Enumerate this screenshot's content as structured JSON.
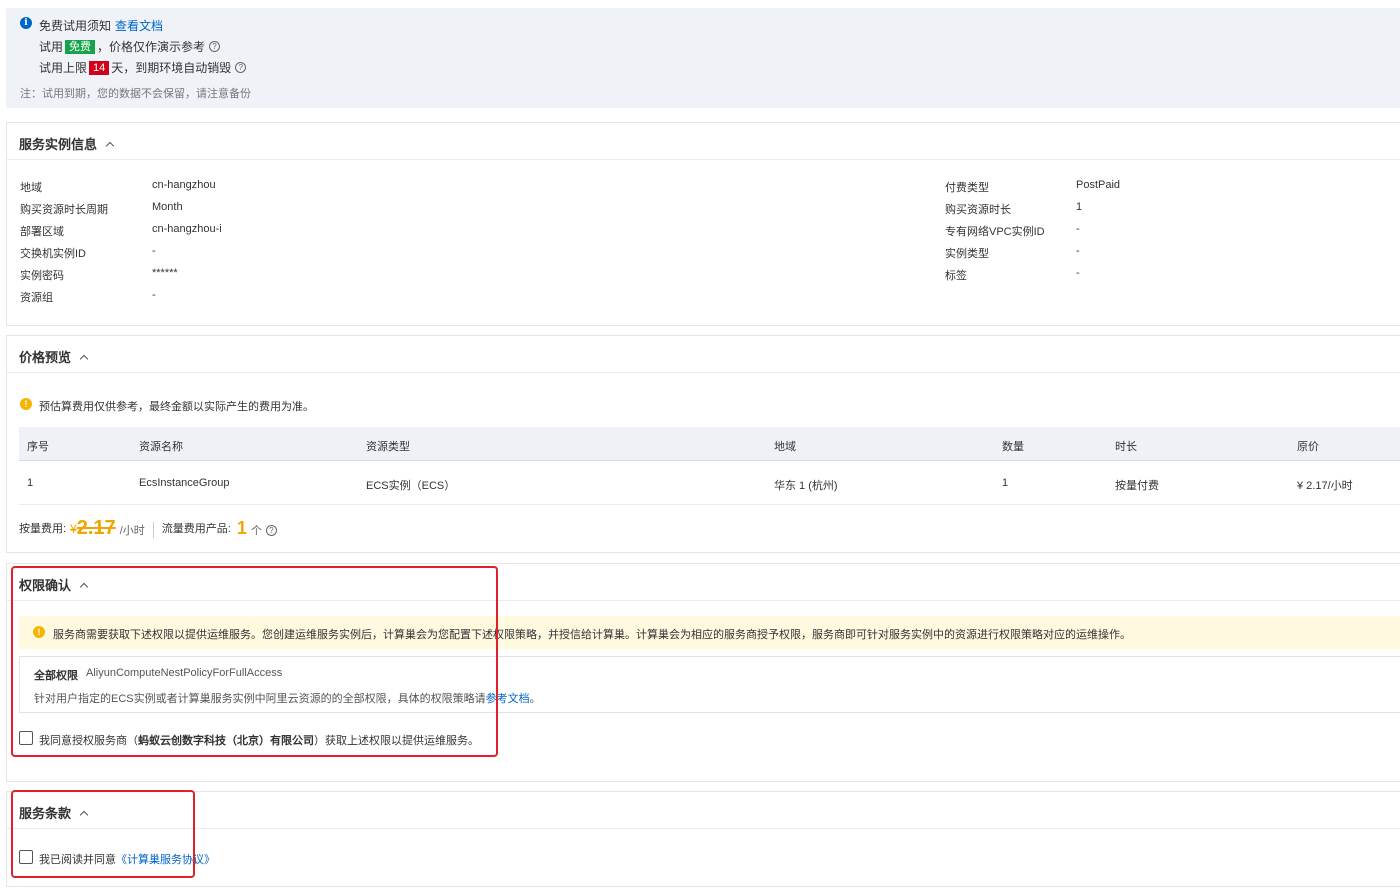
{
  "notice": {
    "title": "免费试用须知",
    "doc_link": "查看文档",
    "row1_prefix": "试用",
    "row1_badge": "免费",
    "row1_suffix": "，价格仅作演示参考",
    "row2_prefix": "试用上限",
    "row2_badge": "14",
    "row2_suffix": "天，到期环境自动销毁",
    "footnote": "注：试用到期，您的数据不会保留，请注意备份"
  },
  "service_info": {
    "title": "服务实例信息",
    "left": [
      {
        "label": "地域",
        "value": "cn-hangzhou"
      },
      {
        "label": "购买资源时长周期",
        "value": "Month"
      },
      {
        "label": "部署区域",
        "value": "cn-hangzhou-i"
      },
      {
        "label": "交换机实例ID",
        "value": "-"
      },
      {
        "label": "实例密码",
        "value": "******"
      },
      {
        "label": "资源组",
        "value": "-"
      }
    ],
    "right": [
      {
        "label": "付费类型",
        "value": "PostPaid"
      },
      {
        "label": "购买资源时长",
        "value": "1"
      },
      {
        "label": "专有网络VPC实例ID",
        "value": "-"
      },
      {
        "label": "实例类型",
        "value": "-"
      },
      {
        "label": "标签",
        "value": "-"
      }
    ]
  },
  "price": {
    "title": "价格预览",
    "warning": "预估算费用仅供参考，最终金额以实际产生的费用为准。",
    "columns": [
      "序号",
      "资源名称",
      "资源类型",
      "地域",
      "数量",
      "时长",
      "原价"
    ],
    "rows": [
      [
        "1",
        "EcsInstanceGroup",
        "ECS实例（ECS）",
        "华东 1 (杭州)",
        "1",
        "按量付费",
        "¥ 2.17/小时"
      ]
    ],
    "summary_label": "按量费用:",
    "summary_currency": "¥",
    "summary_amount": "2.17",
    "summary_unit": "/小时",
    "traffic_label": "流量费用产品:",
    "traffic_count": "1",
    "traffic_unit": "个"
  },
  "permission": {
    "title": "权限确认",
    "warning": "服务商需要获取下述权限以提供运维服务。您创建运维服务实例后，计算巢会为您配置下述权限策略，并授信给计算巢。计算巢会为相应的服务商授予权限，服务商即可针对服务实例中的资源进行权限策略对应的运维操作。",
    "policy_label": "全部权限",
    "policy_name": "AliyunComputeNestPolicyForFullAccess",
    "policy_desc": "针对用户指定的ECS实例或者计算巢服务实例中阿里云资源的的全部权限，具体的权限策略请",
    "policy_link": "参考文档",
    "policy_end": "。",
    "agree_prefix": "我同意授权服务商（",
    "agree_company": "蚂蚁云创数字科技（北京）有限公司",
    "agree_suffix": "）获取上述权限以提供运维服务。"
  },
  "terms": {
    "title": "服务条款",
    "agree_prefix": "我已阅读并同意",
    "agree_link": "《计算巢服务协议》"
  },
  "colors": {
    "accent": "#0064c8",
    "badge_green": "#16a34a",
    "badge_red": "#d0021b",
    "price_orange": "#f0a500",
    "highlight_red": "#e0202a",
    "warning_bg": "#fff9e0"
  }
}
